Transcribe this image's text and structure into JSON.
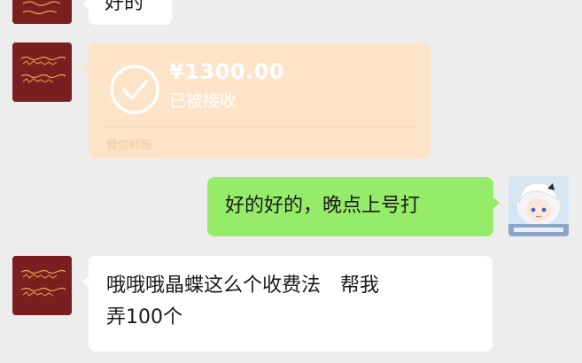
{
  "messages": [
    {
      "id": "m0",
      "sender": "left",
      "type": "text",
      "text": "好的"
    },
    {
      "id": "m1",
      "sender": "left",
      "type": "transfer",
      "amount": "¥1300.00",
      "status": "已被接收",
      "footer": "微信转账"
    },
    {
      "id": "m2",
      "sender": "right",
      "type": "text",
      "text": "好的好的，晚点上号打"
    },
    {
      "id": "m3",
      "sender": "left",
      "type": "text",
      "text": "哦哦哦晶蝶这么个收费法　帮我弄100个"
    }
  ],
  "colors": {
    "background": "#ededed",
    "bubble_incoming": "#ffffff",
    "bubble_outgoing": "#95ec69",
    "transfer_card": "#fde3c8",
    "avatar_left_bg": "#7a1f1f"
  },
  "icons": {
    "transfer_status": "check-circle-icon"
  }
}
